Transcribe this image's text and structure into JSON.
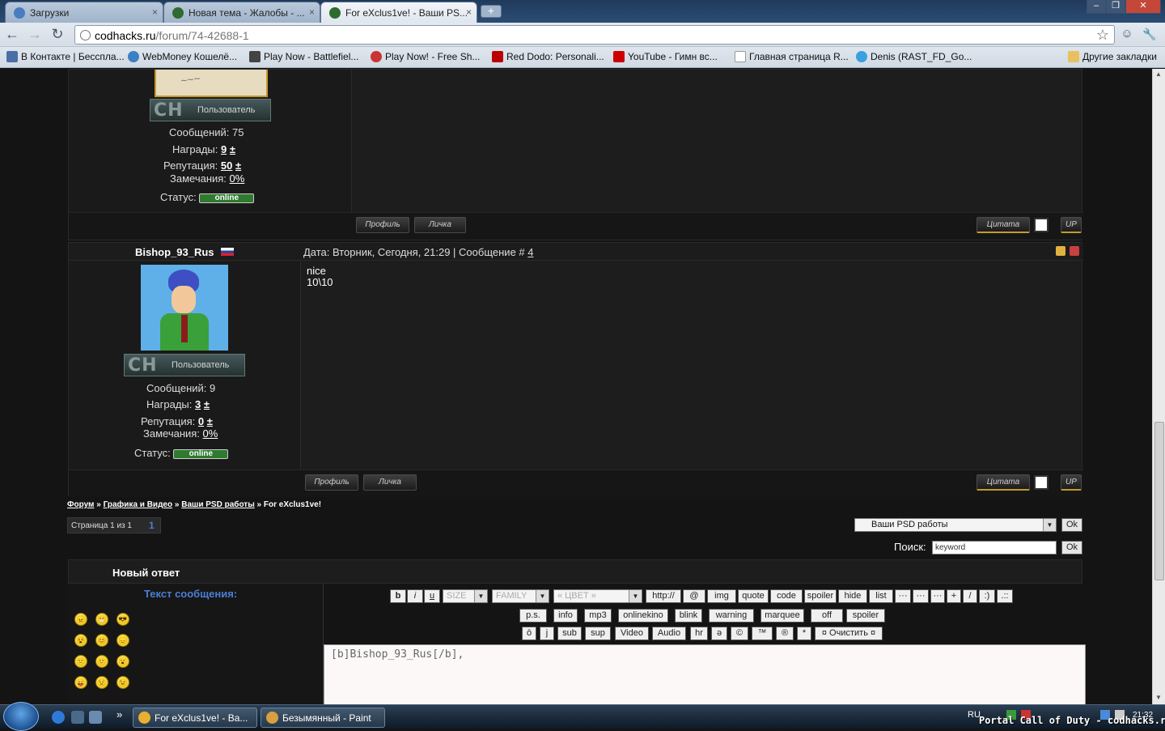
{
  "tabs": [
    {
      "title": "Загрузки",
      "close": "×"
    },
    {
      "title": "Новая тема - Жалобы - ...",
      "close": "×"
    },
    {
      "title": "For eXclus1ve! - Ваши PS...",
      "close": "×"
    }
  ],
  "newtab_label": "+",
  "window_controls": {
    "minimize": "‒",
    "restore": "❐",
    "close": "✕"
  },
  "toolbar": {
    "back": "←",
    "forward": "→",
    "reload": "↻",
    "star": "☆",
    "page_icon": "☺",
    "wrench": "🔧"
  },
  "omnibox": {
    "host": "codhacks.ru",
    "path": "/forum/74-42688-1"
  },
  "bookmarks": [
    {
      "label": "В Контакте | Бесспла...",
      "color": "#4a6fa5"
    },
    {
      "label": "WebMoney Кошелё...",
      "color": "#3b7fc4"
    },
    {
      "label": "Play Now - Battlefiel...",
      "color": "#444"
    },
    {
      "label": "Play Now! - Free Sh...",
      "color": "#c33"
    },
    {
      "label": "Red Dodo: Personali...",
      "color": "#b00"
    },
    {
      "label": "YouTube - Гимн вс...",
      "color": "#c00"
    },
    {
      "label": "Главная страница R...",
      "color": "#eee"
    },
    {
      "label": "Denis (RAST_FD_Go...",
      "color": "#3aa0e0"
    }
  ],
  "other_bookmarks": "Другие закладки",
  "post3": {
    "rank": "Пользователь",
    "messages": "Сообщений: 75",
    "awards_label": "Награды:",
    "awards_value": "9",
    "rep_label": "Репутация:",
    "rep_value": "50",
    "plus": "±",
    "warn_label": "Замечания:",
    "warn_value": "0%",
    "status_label": "Статус:",
    "status_value": "online",
    "profile": "Профиль",
    "pm": "Личка",
    "quote": "Цитата",
    "up": "UP"
  },
  "post4": {
    "author": "Bishop_93_Rus",
    "date_text": "Дата: Вторник, Сегодня, 21:29 | Сообщение #",
    "number": "4",
    "body_line1": "nice",
    "body_line2": "10\\10",
    "rank": "Пользователь",
    "messages": "Сообщений: 9",
    "awards_label": "Награды:",
    "awards_value": "3",
    "rep_label": "Репутация:",
    "rep_value": "0",
    "plus": "±",
    "warn_label": "Замечания:",
    "warn_value": "0%",
    "status_label": "Статус:",
    "status_value": "online",
    "profile": "Профиль",
    "pm": "Личка",
    "quote": "Цитата",
    "up": "UP"
  },
  "breadcrumb": {
    "forum": "Форум",
    "sep": "»",
    "section": "Графика и Видео",
    "subsection": "Ваши PSD работы",
    "current": "For eXclus1ve!"
  },
  "pagination": {
    "label": "Страница 1 из 1",
    "page": "1"
  },
  "forum_jump": {
    "selected": "Ваши PSD работы",
    "ok": "Ok"
  },
  "search": {
    "label": "Поиск:",
    "value": "keyword",
    "ok": "Ok"
  },
  "reply": {
    "header": "Новый ответ",
    "text_label": "Текст сообщения:",
    "textarea_value": "[b]Bishop_93_Rus[/b],"
  },
  "editor_row1": {
    "b": "b",
    "i": "i",
    "u": "u",
    "size": "SIZE",
    "family": "FAMILY",
    "color": "« ЦВЕТ »",
    "buttons": [
      "http://",
      "@",
      "img",
      "quote",
      "code",
      "spoiler",
      "hide",
      "list",
      "···",
      "···",
      "···",
      "+",
      "/",
      ":)",
      ".::"
    ]
  },
  "editor_row2": [
    "p.s.",
    "info",
    "mp3",
    "onlinekino",
    "blink",
    "warning",
    "marquee",
    "off",
    "spoiler"
  ],
  "editor_row3": [
    "ō",
    "j",
    "sub",
    "sup",
    "Video",
    "Audio",
    "hr",
    "ə",
    "©",
    "™",
    "®",
    "*",
    "¤ Очистить ¤"
  ],
  "smileys": [
    "😠",
    "😁",
    "😎",
    "😵",
    "😊",
    "😞",
    "🙁",
    "🙂",
    "😮",
    "😛",
    "😟",
    "😉"
  ],
  "taskbar": {
    "items": [
      {
        "label": "For eXclus1ve! - Ва...",
        "color": "#e8b030"
      },
      {
        "label": "Безымянный - Paint",
        "color": "#d8a040"
      }
    ],
    "quick_more": "»",
    "lang": "RU",
    "clock": "21:32"
  },
  "watermark": "Portal Call of Duty - codhacks.ru",
  "colors": {
    "online": "#2e7a2e",
    "link_blue": "#4a7fd4",
    "accent_gold": "#c79a2a"
  }
}
